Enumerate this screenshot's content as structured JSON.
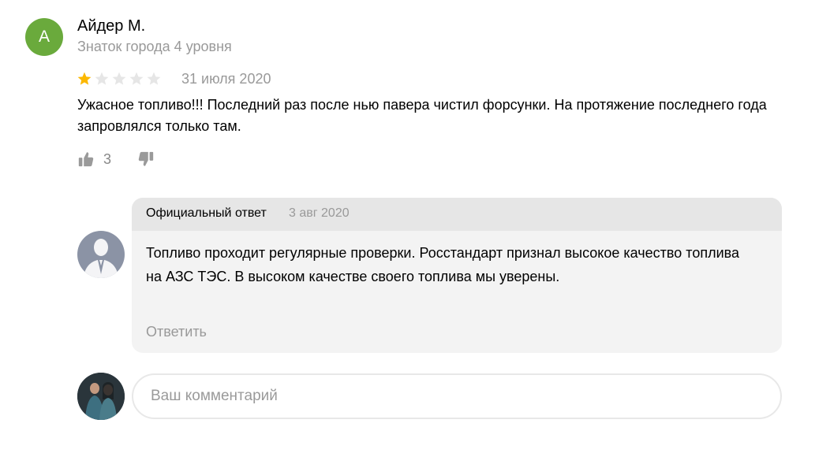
{
  "review": {
    "author_initial": "А",
    "author_name": "Айдер М.",
    "author_level": "Знаток города 4 уровня",
    "rating": 1,
    "rating_max": 5,
    "date": "31 июля 2020",
    "text": "Ужасное топливо!!! Последний раз после нью павера чистил форсунки. На протяжение последнего года запровлялся только там.",
    "likes": "3",
    "colors": {
      "avatar": "#6aaa3c",
      "star_active": "#fcb800",
      "star_inactive": "#e6e6e6"
    }
  },
  "reply": {
    "label": "Официальный ответ",
    "date": "3 авг 2020",
    "text": "Топливо проходит регулярные проверки. Росстандарт признал высокое качество топлива на АЗС ТЭС. В высоком качестве своего топлива мы уверены.",
    "action_label": "Ответить"
  },
  "comment": {
    "placeholder": "Ваш комментарий"
  },
  "icons": {
    "like": "thumbs-up-icon",
    "dislike": "thumbs-down-icon",
    "star": "star-icon"
  }
}
